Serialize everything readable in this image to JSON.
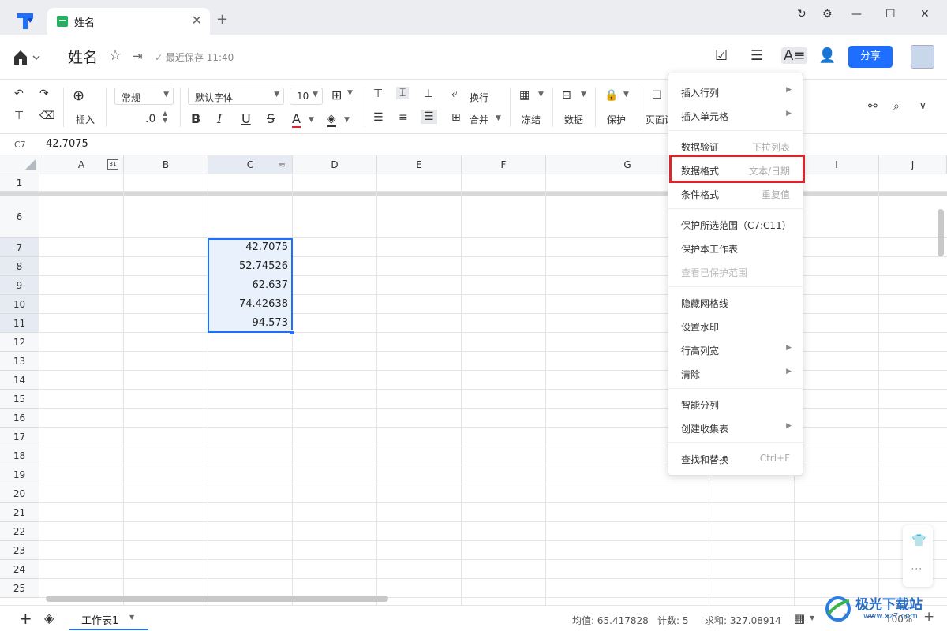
{
  "tab": {
    "label": "姓名"
  },
  "header": {
    "title": "姓名",
    "saved": "最近保存 11:40",
    "share": "分享"
  },
  "toolbar": {
    "insert": "插入",
    "format_select": "常规",
    "decimal": ".0",
    "font_select": "默认字体",
    "size_select": "10",
    "wrap": "换行",
    "merge": "合并",
    "freeze": "冻结",
    "data": "数据",
    "protect": "保护",
    "page": "页面设"
  },
  "formula": {
    "ref": "C7",
    "value": "42.7075"
  },
  "columns": [
    "A",
    "B",
    "C",
    "D",
    "E",
    "F",
    "G",
    "H",
    "I",
    "J"
  ],
  "rows": [
    "1",
    "6",
    "7",
    "8",
    "9",
    "10",
    "11",
    "12",
    "13",
    "14",
    "15",
    "16",
    "17",
    "18",
    "19",
    "20",
    "21",
    "22",
    "23",
    "24",
    "25"
  ],
  "cells": [
    "42.7075",
    "52.74526",
    "62.637",
    "74.42638",
    "94.573"
  ],
  "menu": {
    "items": [
      {
        "label": "插入行列",
        "shortcut": "",
        "sub": true
      },
      {
        "label": "插入单元格",
        "shortcut": "",
        "sub": true
      },
      {
        "label": "数据验证",
        "shortcut": "下拉列表",
        "sub": false
      },
      {
        "label": "数据格式",
        "shortcut": "文本/日期",
        "sub": false
      },
      {
        "label": "条件格式",
        "shortcut": "重复值",
        "sub": false
      },
      {
        "label": "保护所选范围（C7:C11）",
        "shortcut": "",
        "sub": false
      },
      {
        "label": "保护本工作表",
        "shortcut": "",
        "sub": false
      },
      {
        "label": "查看已保护范围",
        "shortcut": "",
        "sub": false
      },
      {
        "label": "隐藏网格线",
        "shortcut": "",
        "sub": false
      },
      {
        "label": "设置水印",
        "shortcut": "",
        "sub": false
      },
      {
        "label": "行高列宽",
        "shortcut": "",
        "sub": true
      },
      {
        "label": "清除",
        "shortcut": "",
        "sub": true
      },
      {
        "label": "智能分列",
        "shortcut": "",
        "sub": false
      },
      {
        "label": "创建收集表",
        "shortcut": "",
        "sub": true
      },
      {
        "label": "查找和替换",
        "shortcut": "Ctrl+F",
        "sub": false
      }
    ]
  },
  "sheet": {
    "tab": "工作表1"
  },
  "status": {
    "avg": "均值: 65.417828",
    "count": "计数: 5",
    "sum": "求和: 327.08914",
    "zoom": "100%"
  },
  "watermark": {
    "text": "极光下载站",
    "sub": "www.xz7.com"
  },
  "colors": {
    "accent": "#1e6fff",
    "highlight": "#d9262c",
    "selection": "#e8f1fc"
  }
}
